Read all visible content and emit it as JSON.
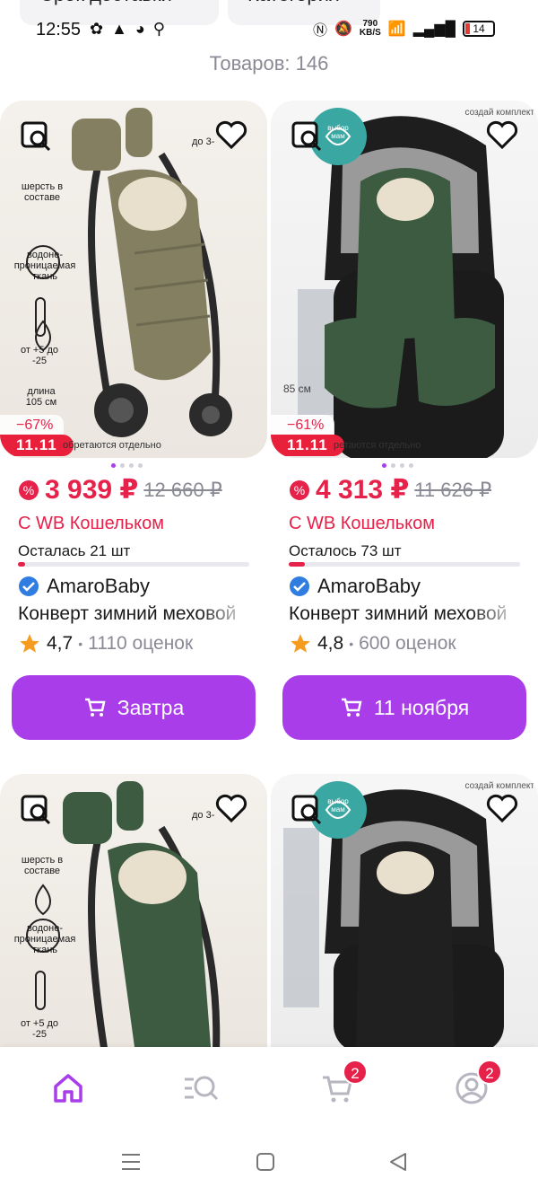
{
  "filters": {
    "pill1": "Срок доставки",
    "pill2": "Категория"
  },
  "status_bar": {
    "time": "12:55",
    "net_speed_value": "790",
    "net_speed_unit": "KB/S",
    "battery": "14"
  },
  "products_count": "Товаров: 146",
  "products": [
    {
      "discount": "−67%",
      "sale_badge": "11.11",
      "image_footnote": "обретаются отдельно",
      "price": "3 939 ₽",
      "old_price": "12 660 ₽",
      "wallet_label": "С WB Кошельком",
      "stock": "Осталась 21 шт",
      "stock_fraction": 0.02,
      "brand": "AmaroBaby",
      "title": "Конверт зимний меховой",
      "rating": "4,7",
      "reviews": "1110 оценок",
      "button": "Завтра",
      "img_labels": [
        "шерсть в составе",
        "водоне- проницаемая ткань",
        "от +5 до -25",
        "длина 105 см",
        "до 3-"
      ]
    },
    {
      "discount": "−61%",
      "sale_badge": "11.11",
      "image_footnote": "ретаются отдельно",
      "price": "4 313 ₽",
      "old_price": "11 626 ₽",
      "wallet_label": "С WB Кошельком",
      "stock": "Осталось 73 шт",
      "stock_fraction": 0.07,
      "brand": "AmaroBaby",
      "title": "Конверт зимний меховой",
      "rating": "4,8",
      "reviews": "600 оценок",
      "button": "11 ноября",
      "img_labels": [
        "создай комплект",
        "85 см",
        "выбор мам"
      ]
    },
    {
      "img_labels": [
        "шерсть в составе",
        "водоне- проницаемая ткань",
        "от +5 до -25",
        "до 3-"
      ]
    },
    {
      "img_labels": [
        "создай комплект",
        "выбор мам"
      ]
    }
  ],
  "nav": {
    "cart_badge": "2",
    "profile_badge": "2"
  },
  "colors": {
    "accent": "#a93dea",
    "price": "#e6214a",
    "muted": "#8a8a95"
  }
}
